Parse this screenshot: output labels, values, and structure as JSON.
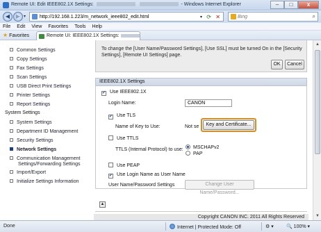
{
  "window": {
    "title_prefix": "Remote UI: Edit IEEE802.1X Settings:",
    "title_suffix": "- Windows Internet Explorer",
    "minimize_glyph": "–",
    "restore_glyph": "□",
    "close_glyph": "x"
  },
  "address": {
    "back_glyph": "◀",
    "forward_glyph": "▶",
    "url": "http://192.168.1.223/m_network_ieee802_edit.html",
    "search_placeholder": "Bing"
  },
  "menu": [
    "File",
    "Edit",
    "View",
    "Favorites",
    "Tools",
    "Help"
  ],
  "favorites": {
    "label": "Favorites",
    "tab_title": "Remote UI: IEEE802.1X Settings:"
  },
  "sidebar": {
    "items_top": [
      "Common Settings",
      "Copy Settings",
      "Fax Settings",
      "Scan Settings",
      "USB Direct Print Settings",
      "Printer Settings",
      "Report Settings"
    ],
    "group_heading": "System Settings",
    "items_system": [
      "System Settings",
      "Department ID Management",
      "Security Settings",
      "Network Settings",
      "Communication Management",
      "Settings/Forwarding Settings",
      "Import/Export",
      "Initialize Settings Information"
    ],
    "active_item": "Network Settings"
  },
  "notice": {
    "line1": "To change the [User Name/Password Settings], [Use SSL] must be turned On in the [Security",
    "line2": "Settings], [Remote UI Settings] page.",
    "ok_label": "OK",
    "cancel_label": "Cancel"
  },
  "ieee": {
    "section_title": "IEEE802.1X Settings",
    "use_ieee_label": "Use IEEE802.1X",
    "use_ieee_checked": true,
    "login_name_label": "Login Name:",
    "login_name_value": "CANON",
    "use_tls_label": "Use TLS",
    "use_tls_checked": true,
    "key_name_label": "Name of Key to Use:",
    "key_name_value": "Not se",
    "key_cert_button": "Key and Certificate...",
    "use_ttls_label": "Use TTLS",
    "use_ttls_checked": false,
    "ttls_protocol_label": "TTLS (Internal Protocol) to use:",
    "ttls_options": [
      "MSCHAPv2",
      "PAP"
    ],
    "ttls_selected": "MSCHAPv2",
    "use_peap_label": "Use PEAP",
    "use_peap_checked": false,
    "use_login_as_user_label": "Use Login Name as User Name",
    "use_login_as_user_checked": true,
    "user_pass_label": "User Name/Password Settings",
    "change_user_button": "Change User Name/Password...",
    "check_glyph": "✔"
  },
  "footer": {
    "copyright": "Copyright CANON INC. 2011 All Rights Reserved"
  },
  "status": {
    "done": "Done",
    "zone": "Internet | Protected Mode: Off",
    "zoom": "100%"
  }
}
